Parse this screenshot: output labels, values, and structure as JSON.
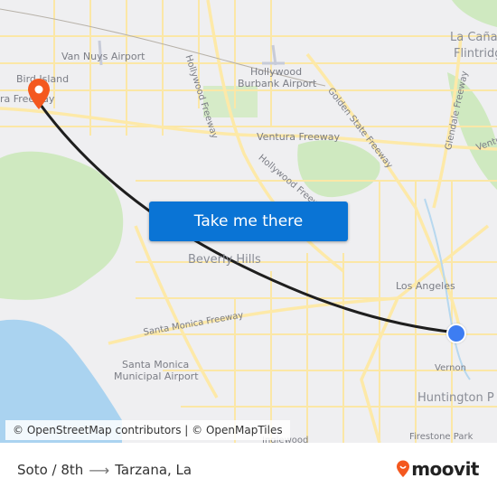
{
  "map": {
    "labels": [
      {
        "text": "Van Nuys Airport",
        "kind": "airport"
      },
      {
        "text": "Bird Island",
        "kind": "place"
      },
      {
        "text": "ra Freeway",
        "kind": "road"
      },
      {
        "text": "Hollywood Freeway",
        "kind": "road"
      },
      {
        "text": "Hollywood",
        "kind": "airport"
      },
      {
        "text": "Burbank Airport",
        "kind": "airport"
      },
      {
        "text": "Golden State Freeway",
        "kind": "road"
      },
      {
        "text": "Ventura Freeway",
        "kind": "road"
      },
      {
        "text": "Hollywood Freeway",
        "kind": "road"
      },
      {
        "text": "La Cañada",
        "kind": "city"
      },
      {
        "text": "Flintridge",
        "kind": "city"
      },
      {
        "text": "Glendale Freeway",
        "kind": "road"
      },
      {
        "text": "Ventura",
        "kind": "road"
      },
      {
        "text": "Beverly Hills",
        "kind": "city"
      },
      {
        "text": "Los Angeles",
        "kind": "city"
      },
      {
        "text": "Santa Monica Freeway",
        "kind": "road"
      },
      {
        "text": "Santa Monica",
        "kind": "airport"
      },
      {
        "text": "Municipal Airport",
        "kind": "airport"
      },
      {
        "text": "Vernon",
        "kind": "place"
      },
      {
        "text": "Huntington P",
        "kind": "city"
      },
      {
        "text": "Firestone Park",
        "kind": "place"
      },
      {
        "text": "Inglewood",
        "kind": "place"
      }
    ],
    "origin_marker": {
      "icon": "current-location-dot-icon",
      "color": "#3d7df2"
    },
    "destination_marker": {
      "icon": "map-pin-icon",
      "color": "#f4581f"
    },
    "route_color": "#1e1e1e"
  },
  "cta": {
    "label": "Take me there",
    "color": "#0a74d5"
  },
  "attribution": {
    "osm": "© OpenStreetMap contributors",
    "separator": " | ",
    "omt": "© OpenMapTiles"
  },
  "footer": {
    "origin": "Soto / 8th",
    "arrow_icon": "arrow-right-icon",
    "destination": "Tarzana, La",
    "brand": "moovit",
    "brand_color": "#f4581f"
  }
}
